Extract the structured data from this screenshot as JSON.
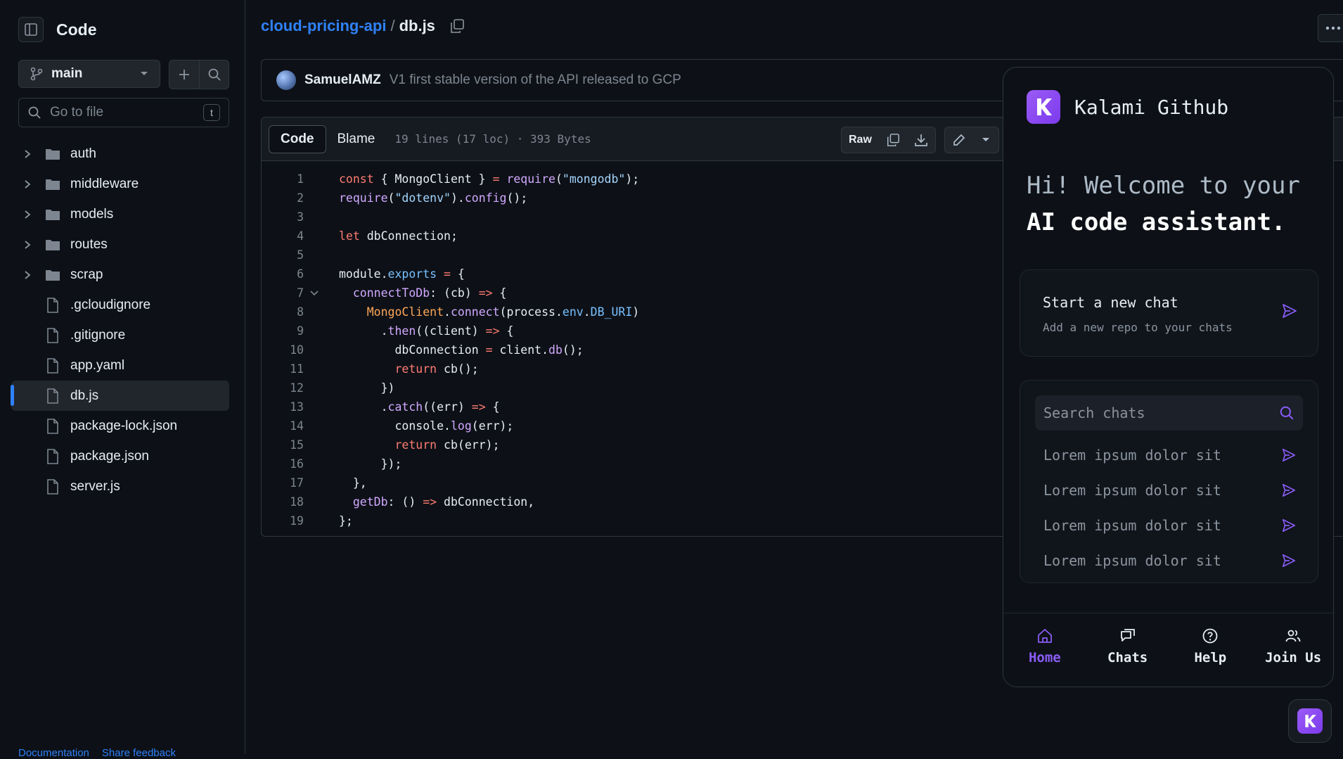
{
  "sidebar": {
    "title": "Code",
    "branch": "main",
    "go_to_file_placeholder": "Go to file",
    "go_to_file_shortcut": "t",
    "folders": [
      "auth",
      "middleware",
      "models",
      "routes",
      "scrap"
    ],
    "files": [
      ".gcloudignore",
      ".gitignore",
      "app.yaml",
      "db.js",
      "package-lock.json",
      "package.json",
      "server.js"
    ],
    "active_file": "db.js",
    "footer": [
      "Documentation",
      "Share feedback"
    ]
  },
  "breadcrumb": {
    "repo": "cloud-pricing-api",
    "separator": "/",
    "file": "db.js"
  },
  "commit": {
    "author": "SamuelAMZ",
    "message": "V1 first stable version of the API released to GCP"
  },
  "file_view": {
    "tabs": [
      "Code",
      "Blame"
    ],
    "active_tab": "Code",
    "meta": "19 lines (17 loc) · 393 Bytes",
    "raw_label": "Raw",
    "line_numbers": [
      "1",
      "2",
      "3",
      "4",
      "5",
      "6",
      "7",
      "8",
      "9",
      "10",
      "11",
      "12",
      "13",
      "14",
      "15",
      "16",
      "17",
      "18",
      "19"
    ]
  },
  "assistant": {
    "title": "Kalami Github",
    "greeting_line1": "Hi! Welcome to your",
    "greeting_line2": "AI code assistant.",
    "new_chat_title": "Start a new chat",
    "new_chat_subtitle": "Add a new repo to your chats",
    "search_placeholder": "Search chats",
    "chats": [
      "Lorem ipsum dolor sit",
      "Lorem ipsum dolor sit",
      "Lorem ipsum dolor sit",
      "Lorem ipsum dolor sit"
    ],
    "nav": [
      "Home",
      "Chats",
      "Help",
      "Join Us"
    ],
    "accent": "#8b5cf6"
  },
  "colors": {
    "link": "#2f81f7",
    "background": "#0d1117",
    "border": "#30363d"
  }
}
